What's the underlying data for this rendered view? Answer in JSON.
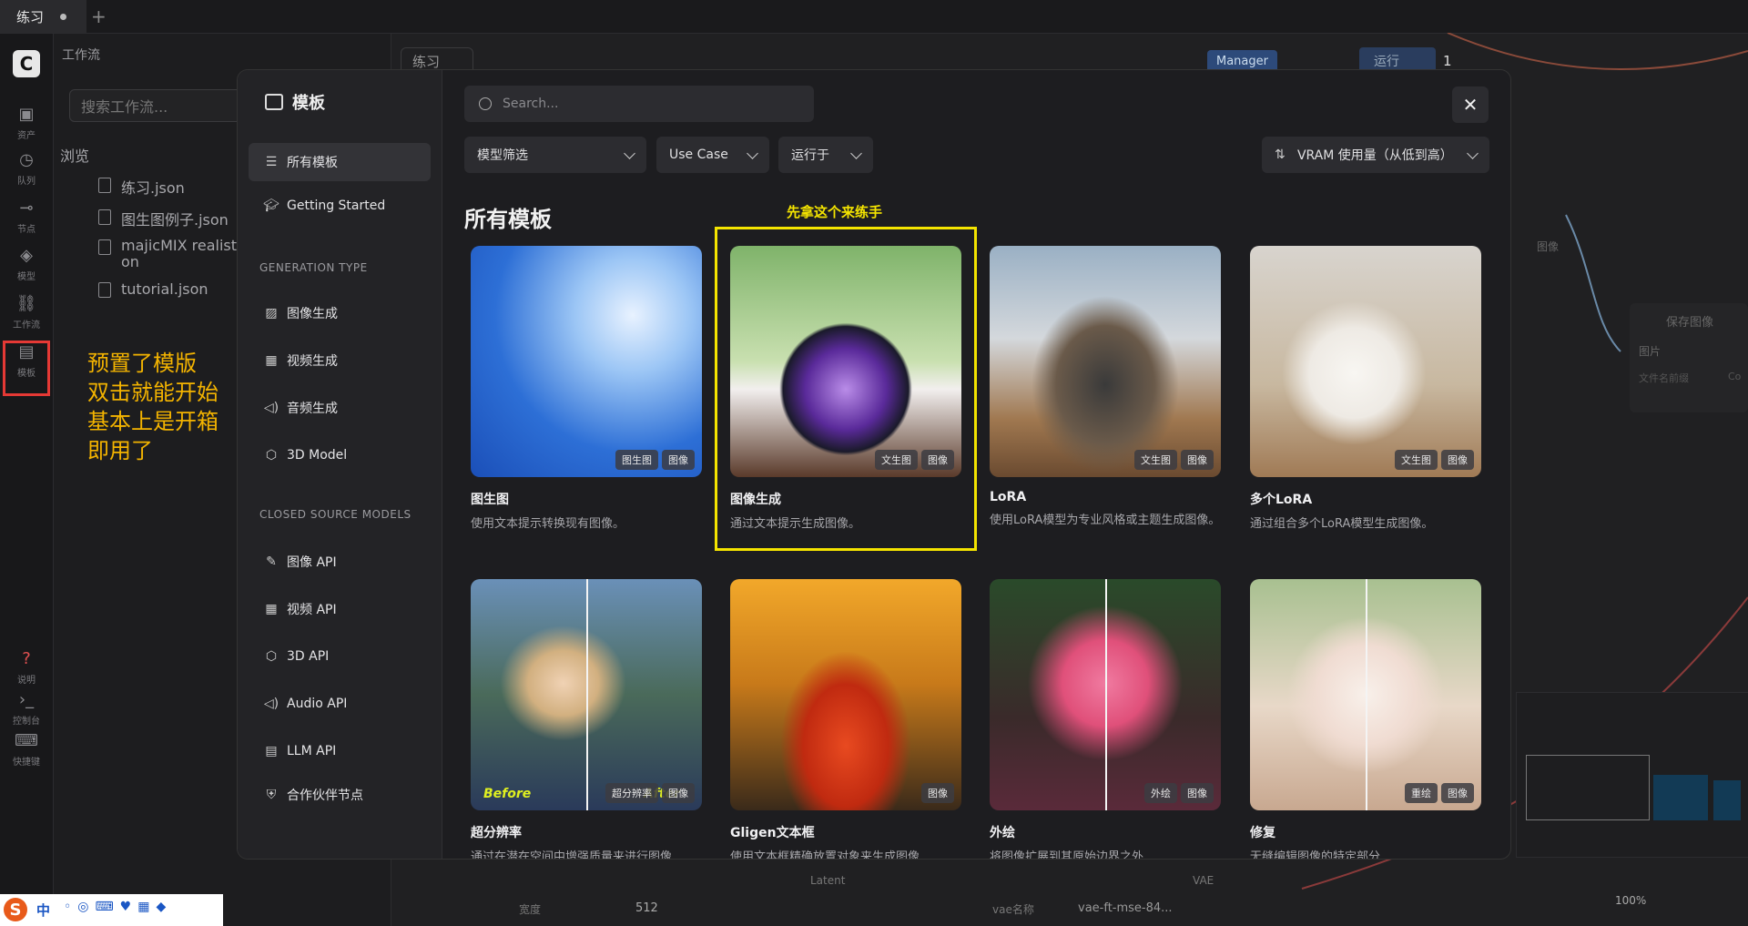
{
  "tabbar": {
    "tab_label": "练习",
    "plus": "+"
  },
  "rail": [
    {
      "icon": "image-icon",
      "glyph": "▣",
      "label": "资产"
    },
    {
      "icon": "history-icon",
      "glyph": "◷",
      "label": "队列"
    },
    {
      "icon": "node-icon",
      "glyph": "⊸",
      "label": "节点"
    },
    {
      "icon": "model-icon",
      "glyph": "◈",
      "label": "模型"
    },
    {
      "icon": "workflow-icon",
      "glyph": "⛓",
      "label": "工作流"
    },
    {
      "icon": "template-icon",
      "glyph": "▤",
      "label": "模板"
    },
    {
      "icon": "help-icon",
      "glyph": "?",
      "label": "说明"
    },
    {
      "icon": "console-icon",
      "glyph": "›_",
      "label": "控制台"
    },
    {
      "icon": "keyboard-icon",
      "glyph": "⌨",
      "label": "快捷键"
    }
  ],
  "workflow_panel": {
    "title": "工作流",
    "search_placeholder": "搜索工作流...",
    "browse_label": "浏览",
    "files": [
      "练习.json",
      "图生图例子.json",
      "majicMIX realistic",
      "tutorial.json"
    ],
    "file3_cont": "on"
  },
  "annotation": {
    "lines": [
      "预置了模版",
      "双击就能开始",
      "基本上是开箱",
      "即用了"
    ]
  },
  "canvas": {
    "workflow_tab": "练习",
    "manager_label": "Manager",
    "run_label": "运行",
    "run_count": "1",
    "node_image_label": "图像",
    "save_node_title": "保存图像",
    "save_node_image": "图片",
    "save_node_prefix": "文件名前缀",
    "save_node_prefix_val": "Co",
    "latent_label": "Latent",
    "vae_label": "VAE",
    "width_label": "宽度",
    "width_value": "512",
    "vae_name_label": "vae名称",
    "vae_name_value": "vae-ft-mse-84...",
    "zoom": "100%"
  },
  "modal": {
    "title": "模板",
    "search_placeholder": "Search...",
    "nav_all": "所有模板",
    "nav_getting_started": "Getting Started",
    "section_generation": "GENERATION TYPE",
    "gen_items": [
      {
        "icon": "image-gen-icon",
        "glyph": "▨",
        "label": "图像生成"
      },
      {
        "icon": "video-gen-icon",
        "glyph": "▦",
        "label": "视频生成"
      },
      {
        "icon": "audio-gen-icon",
        "glyph": "◁)",
        "label": "音频生成"
      },
      {
        "icon": "cube-icon",
        "glyph": "⬡",
        "label": "3D Model"
      }
    ],
    "section_closed": "CLOSED SOURCE MODELS",
    "closed_items": [
      {
        "icon": "image-api-icon",
        "glyph": "✎",
        "label": "图像 API"
      },
      {
        "icon": "video-api-icon",
        "glyph": "▦",
        "label": "视频 API"
      },
      {
        "icon": "cube-api-icon",
        "glyph": "⬡",
        "label": "3D API"
      },
      {
        "icon": "audio-api-icon",
        "glyph": "◁)",
        "label": "Audio API"
      },
      {
        "icon": "llm-api-icon",
        "glyph": "▤",
        "label": "LLM API"
      },
      {
        "icon": "partner-icon",
        "glyph": "⛨",
        "label": "合作伙伴节点"
      }
    ],
    "filters": {
      "model_filter": "模型筛选",
      "use_case": "Use Case",
      "runs_on": "运行于",
      "sort": "VRAM 使用量（从低到高）"
    },
    "section_title": "所有模板",
    "hint": "先拿这个来练手",
    "close_glyph": "✕",
    "cards": [
      {
        "title": "图生图",
        "desc": "使用文本提示转换现有图像。",
        "badges": [
          "图生图",
          "图像"
        ],
        "theme": "sky"
      },
      {
        "title": "图像生成",
        "desc": "通过文本提示生成图像。",
        "badges": [
          "文生图",
          "图像"
        ],
        "theme": "bottle"
      },
      {
        "title": "LoRA",
        "desc": "使用LoRA模型为专业风格或主题生成图像。",
        "badges": [
          "文生图",
          "图像"
        ],
        "theme": "mountain"
      },
      {
        "title": "多个LoRA",
        "desc": "通过组合多个LoRA模型生成图像。",
        "badges": [
          "文生图",
          "图像"
        ],
        "theme": "cat"
      },
      {
        "title": "超分辨率",
        "desc": "通过在潜在空间中增强质量来进行图像",
        "badges": [
          "超分辨率",
          "图像"
        ],
        "theme": "portrait",
        "before": "Before",
        "after": "After"
      },
      {
        "title": "Gligen文本框",
        "desc": "使用文本框精确放置对象来生成图像",
        "badges": [
          "图像"
        ],
        "theme": "tomato"
      },
      {
        "title": "外绘",
        "desc": "将图像扩展到其原始边界之外",
        "badges": [
          "外绘",
          "图像"
        ],
        "theme": "rose"
      },
      {
        "title": "修复",
        "desc": "无缝编辑图像的特定部分",
        "badges": [
          "重绘",
          "图像"
        ],
        "theme": "kitten"
      }
    ]
  },
  "ime": {
    "label": "中"
  }
}
